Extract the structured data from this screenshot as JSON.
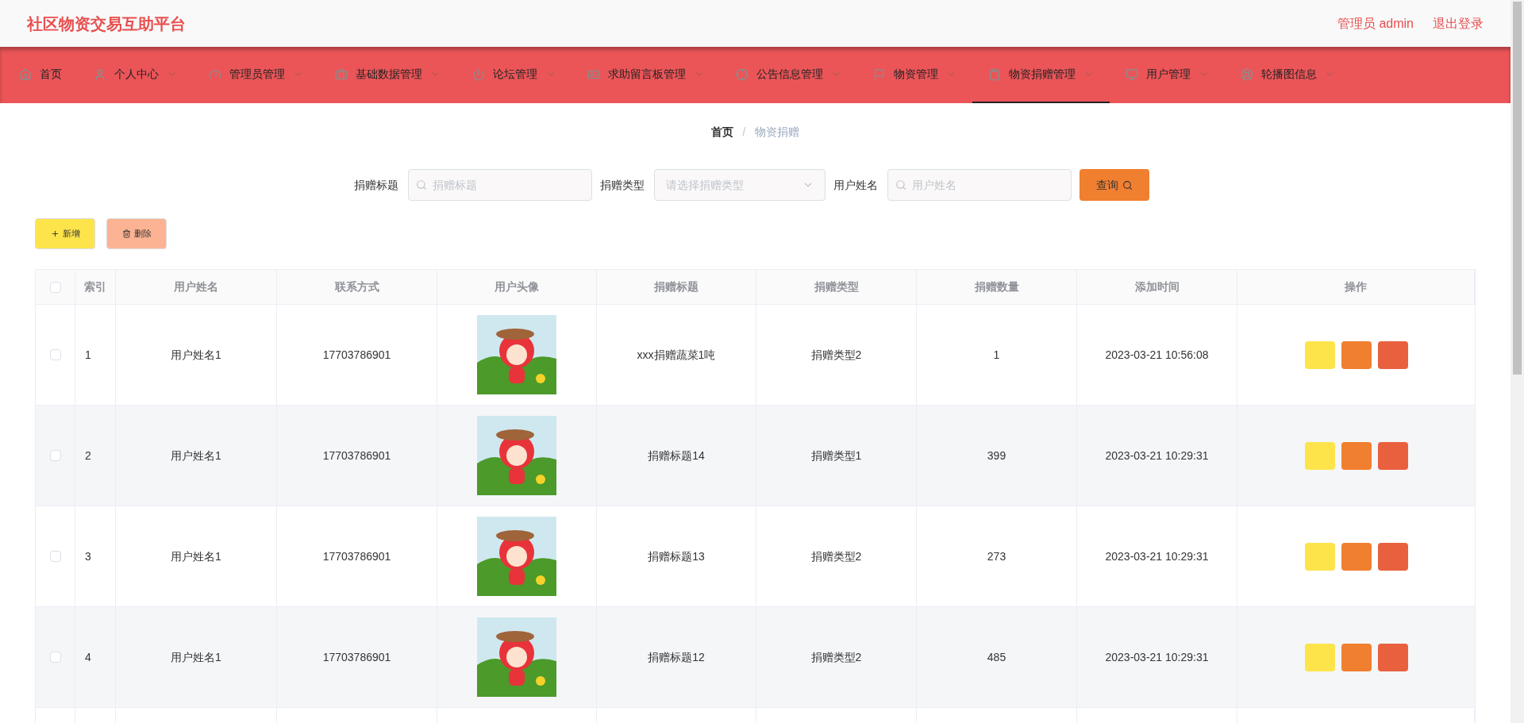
{
  "header": {
    "title": "社区物资交易互助平台",
    "user_label": "管理员 admin",
    "logout": "退出登录"
  },
  "nav": [
    {
      "label": "首页",
      "has_menu": false,
      "selected": false
    },
    {
      "label": "个人中心",
      "has_menu": true,
      "selected": false
    },
    {
      "label": "管理员管理",
      "has_menu": true,
      "selected": false
    },
    {
      "label": "基础数据管理",
      "has_menu": true,
      "selected": false
    },
    {
      "label": "论坛管理",
      "has_menu": true,
      "selected": false
    },
    {
      "label": "求助留言板管理",
      "has_menu": true,
      "selected": false
    },
    {
      "label": "公告信息管理",
      "has_menu": true,
      "selected": false
    },
    {
      "label": "物资管理",
      "has_menu": true,
      "selected": false
    },
    {
      "label": "物资捐赠管理",
      "has_menu": true,
      "selected": true
    },
    {
      "label": "用户管理",
      "has_menu": true,
      "selected": false
    },
    {
      "label": "轮播图信息",
      "has_menu": true,
      "selected": false
    }
  ],
  "breadcrumb": {
    "separator": "/",
    "items": [
      "首页",
      "物资捐赠"
    ]
  },
  "search": {
    "fields": [
      {
        "kind": "text",
        "label": "捐赠标题",
        "placeholder": "捐赠标题"
      },
      {
        "kind": "select",
        "label": "捐赠类型",
        "placeholder": "请选择捐赠类型"
      },
      {
        "kind": "text",
        "label": "用户姓名",
        "placeholder": "用户姓名"
      }
    ],
    "button": "查询"
  },
  "actions": {
    "add": "新增",
    "delete": "删除"
  },
  "table": {
    "all_checked": false,
    "columns": [
      "索引",
      "用户姓名",
      "联系方式",
      "用户头像",
      "捐赠标题",
      "捐赠类型",
      "捐赠数量",
      "添加时间",
      "操作"
    ],
    "rows": [
      {
        "checked": false,
        "index": "1",
        "name": "用户姓名1",
        "phone": "17703786901",
        "title": "xxx捐赠蔬菜1吨",
        "type": "捐赠类型2",
        "count": "1",
        "time": "2023-03-21 10:56:08"
      },
      {
        "checked": false,
        "index": "2",
        "name": "用户姓名1",
        "phone": "17703786901",
        "title": "捐赠标题14",
        "type": "捐赠类型1",
        "count": "399",
        "time": "2023-03-21 10:29:31"
      },
      {
        "checked": false,
        "index": "3",
        "name": "用户姓名1",
        "phone": "17703786901",
        "title": "捐赠标题13",
        "type": "捐赠类型2",
        "count": "273",
        "time": "2023-03-21 10:29:31"
      },
      {
        "checked": false,
        "index": "4",
        "name": "用户姓名1",
        "phone": "17703786901",
        "title": "捐赠标题12",
        "type": "捐赠类型2",
        "count": "485",
        "time": "2023-03-21 10:29:31"
      }
    ]
  }
}
